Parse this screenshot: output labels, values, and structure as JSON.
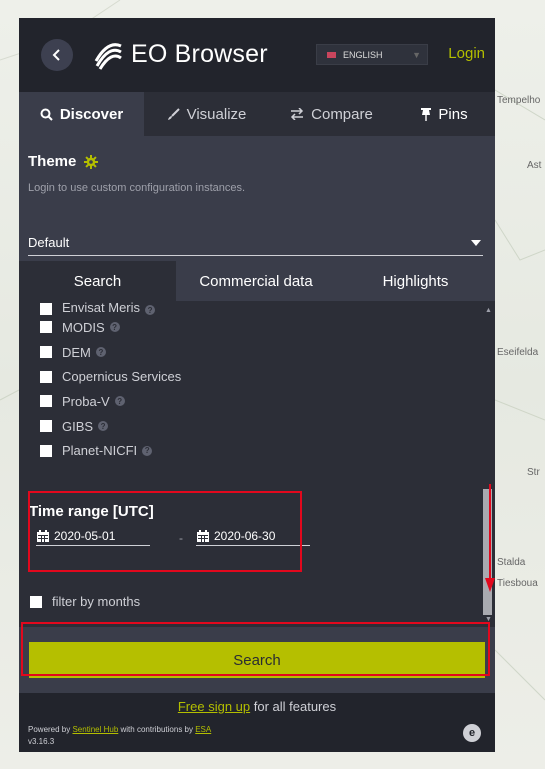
{
  "app": {
    "title": "EO Browser",
    "language": "ENGLISH",
    "login_label": "Login"
  },
  "tabs": [
    {
      "label": "Discover",
      "icon": "search-icon"
    },
    {
      "label": "Visualize",
      "icon": "brush-icon"
    },
    {
      "label": "Compare",
      "icon": "swap-icon"
    },
    {
      "label": "Pins",
      "icon": "pin-icon"
    }
  ],
  "theme": {
    "title": "Theme",
    "subtitle": "Login to use custom configuration instances.",
    "selected": "Default"
  },
  "subtabs": [
    "Search",
    "Commercial data",
    "Highlights"
  ],
  "datasources": [
    "Envisat Meris",
    "MODIS",
    "DEM",
    "Copernicus Services",
    "Proba-V",
    "GIBS",
    "Planet-NICFI"
  ],
  "time_range": {
    "title": "Time range [UTC]",
    "from": "2020-05-01",
    "separator": "-",
    "to": "2020-06-30",
    "filter_label": "filter by months"
  },
  "search_button": "Search",
  "footer": {
    "signup_link": "Free sign up",
    "signup_rest": " for all features",
    "powered_prefix": "Powered by ",
    "sentinel_link": "Sentinel Hub",
    "powered_mid": " with contributions by ",
    "esa_link": "ESA",
    "version": "v3.16.3"
  },
  "map_labels": [
    "Tempelho",
    "Ast",
    "Eseifelda",
    "Str",
    "Stalda",
    "Tiesboua"
  ],
  "colors": {
    "accent": "#b5bf00",
    "panel": "#3a3d4a",
    "dark": "#22242c",
    "annotation": "#e2081d"
  }
}
